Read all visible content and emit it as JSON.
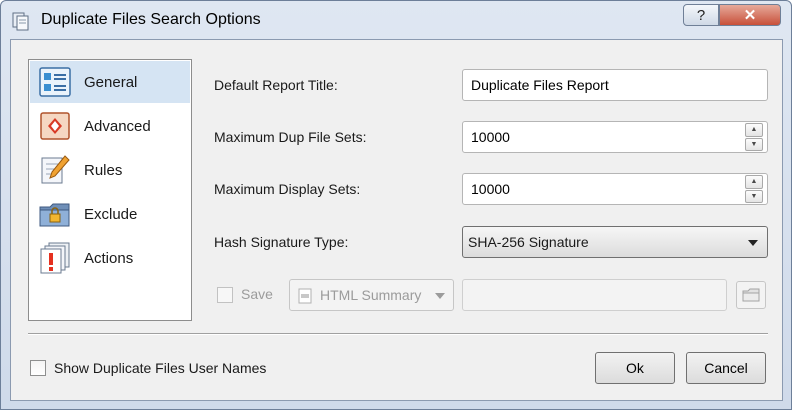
{
  "window": {
    "title": "Duplicate Files Search Options",
    "help_glyph": "?",
    "close_glyph": "✕"
  },
  "nav": {
    "items": [
      {
        "label": "General",
        "icon": "general-settings-icon",
        "selected": true
      },
      {
        "label": "Advanced",
        "icon": "advanced-settings-icon",
        "selected": false
      },
      {
        "label": "Rules",
        "icon": "rules-pencil-icon",
        "selected": false
      },
      {
        "label": "Exclude",
        "icon": "exclude-lock-folder-icon",
        "selected": false
      },
      {
        "label": "Actions",
        "icon": "actions-exclamation-icon",
        "selected": false
      }
    ]
  },
  "form": {
    "report_title_label": "Default Report Title:",
    "report_title_value": "Duplicate Files Report",
    "max_dup_sets_label": "Maximum Dup File Sets:",
    "max_dup_sets_value": "10000",
    "max_display_sets_label": "Maximum Display Sets:",
    "max_display_sets_value": "10000",
    "hash_type_label": "Hash Signature Type:",
    "hash_type_value": "SHA-256 Signature",
    "save_label": "Save",
    "save_format_value": "HTML Summary",
    "save_path_value": ""
  },
  "footer": {
    "show_user_names_label": "Show Duplicate Files User Names",
    "show_user_names_checked": false,
    "ok_label": "Ok",
    "cancel_label": "Cancel"
  },
  "colors": {
    "selection": "#d5e4f3",
    "window_frame": "#dfe7f2",
    "close_button": "#c8503a",
    "disabled_text": "#9b9b9b"
  }
}
